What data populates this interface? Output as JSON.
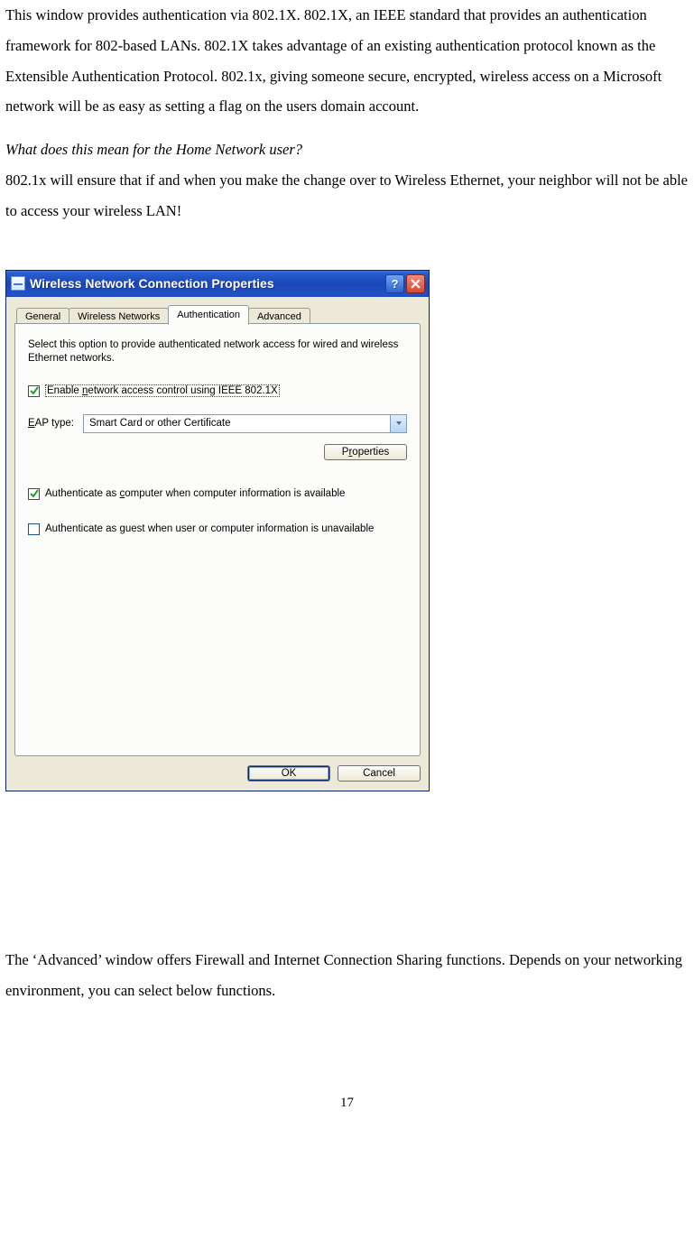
{
  "doc": {
    "para1": "This window provides authentication via 802.1X. 802.1X, an IEEE standard that provides an authentication framework for 802-based LANs. 802.1X takes advantage of an existing authentication protocol known as the Extensible Authentication Protocol. 802.1x, giving someone secure, encrypted, wireless access on a Microsoft network will be as easy as setting a flag on the users domain account.",
    "q_italic": "What does this mean for the Home Network user?",
    "para2": "802.1x will ensure that if and when you make the change over to Wireless Ethernet, your neighbor will not be able to access your wireless LAN!",
    "para3": "The ‘Advanced’ window offers Firewall and Internet Connection Sharing functions. Depends on your networking environment, you can select below functions.",
    "page_number": "17"
  },
  "dialog": {
    "title": "Wireless Network Connection Properties",
    "tabs": {
      "general": "General",
      "wireless": "Wireless Networks",
      "auth": "Authentication",
      "advanced": "Advanced"
    },
    "desc": "Select this option to provide authenticated network access for wired and wireless Ethernet networks.",
    "enable_label_pre": "Enable ",
    "enable_label_u": "n",
    "enable_label_post": "etwork access control using IEEE 802.1X",
    "eap_label_pre": "",
    "eap_label_u": "E",
    "eap_label_post": "AP type:",
    "eap_value": "Smart Card or other Certificate",
    "properties_btn_pre": "P",
    "properties_btn_u": "r",
    "properties_btn_post": "operties",
    "chk_computer_pre": "Authenticate as ",
    "chk_computer_u": "c",
    "chk_computer_post": "omputer when computer information is available",
    "chk_guest_pre": "Authenticate as ",
    "chk_guest_u": "g",
    "chk_guest_post": "uest when user or computer information is unavailable",
    "ok": "OK",
    "cancel": "Cancel"
  }
}
